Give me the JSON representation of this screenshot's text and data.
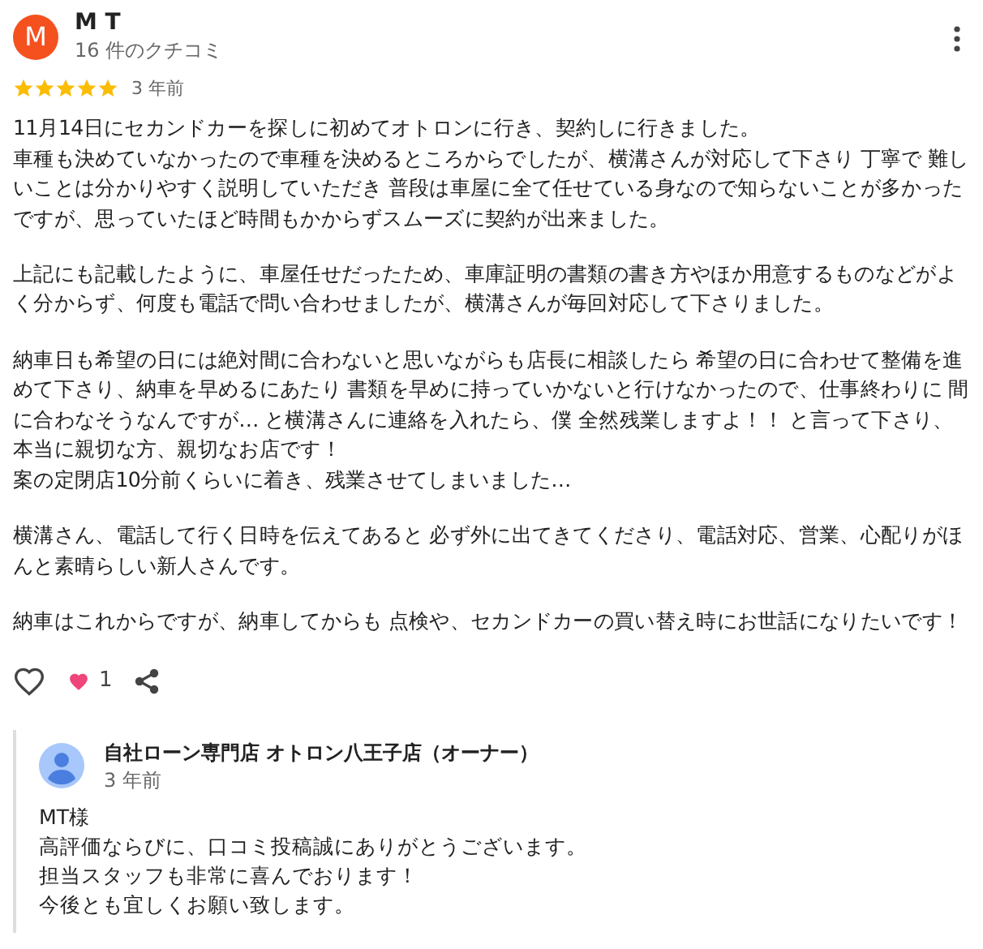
{
  "review": {
    "avatar_letter": "M",
    "author": "M T",
    "review_count": "16 件のクチコミ",
    "stars": 5,
    "time": "3 年前",
    "paragraphs": [
      [
        "11月14日にセカンドカーを探しに初めてオトロンに行き、契約しに行きました。",
        "車種も決めていなかったので車種を決めるところからでしたが、横溝さんが対応して下さり 丁寧で 難しいことは分かりやすく説明していただき 普段は車屋に全て任せている身なので知らないことが多かったですが、思っていたほど時間もかからずスムーズに契約が出来ました。"
      ],
      [
        "上記にも記載したように、車屋任せだったため、車庫証明の書類の書き方やほか用意するものなどがよく分からず、何度も電話で問い合わせましたが、横溝さんが毎回対応して下さりました。"
      ],
      [
        "納車日も希望の日には絶対間に合わないと思いながらも店長に相談したら 希望の日に合わせて整備を進めて下さり、納車を早めるにあたり 書類を早めに持っていかないと行けなかったので、仕事終わりに 間に合わなそうなんですが… と横溝さんに連絡を入れたら、僕 全然残業しますよ！！ と言って下さり、",
        "本当に親切な方、親切なお店です！",
        "案の定閉店10分前くらいに着き、残業させてしまいました…"
      ],
      [
        "横溝さん、電話して行く日時を伝えてあると 必ず外に出てきてくださり、電話対応、営業、心配りがほんと素晴らしい新人さんです。"
      ],
      [
        "納車はこれからですが、納車してからも 点検や、セカンドカーの買い替え時にお世話になりたいです！"
      ]
    ],
    "reaction_count": "1"
  },
  "owner_reply": {
    "name": "自社ローン専門店 オトロン八王子店（オーナー）",
    "time": "3 年前",
    "lines": [
      "MT様",
      "高評価ならびに、口コミ投稿誠にありがとうございます。",
      "担当スタッフも非常に喜んでおります！",
      "今後とも宜しくお願い致します。"
    ]
  }
}
